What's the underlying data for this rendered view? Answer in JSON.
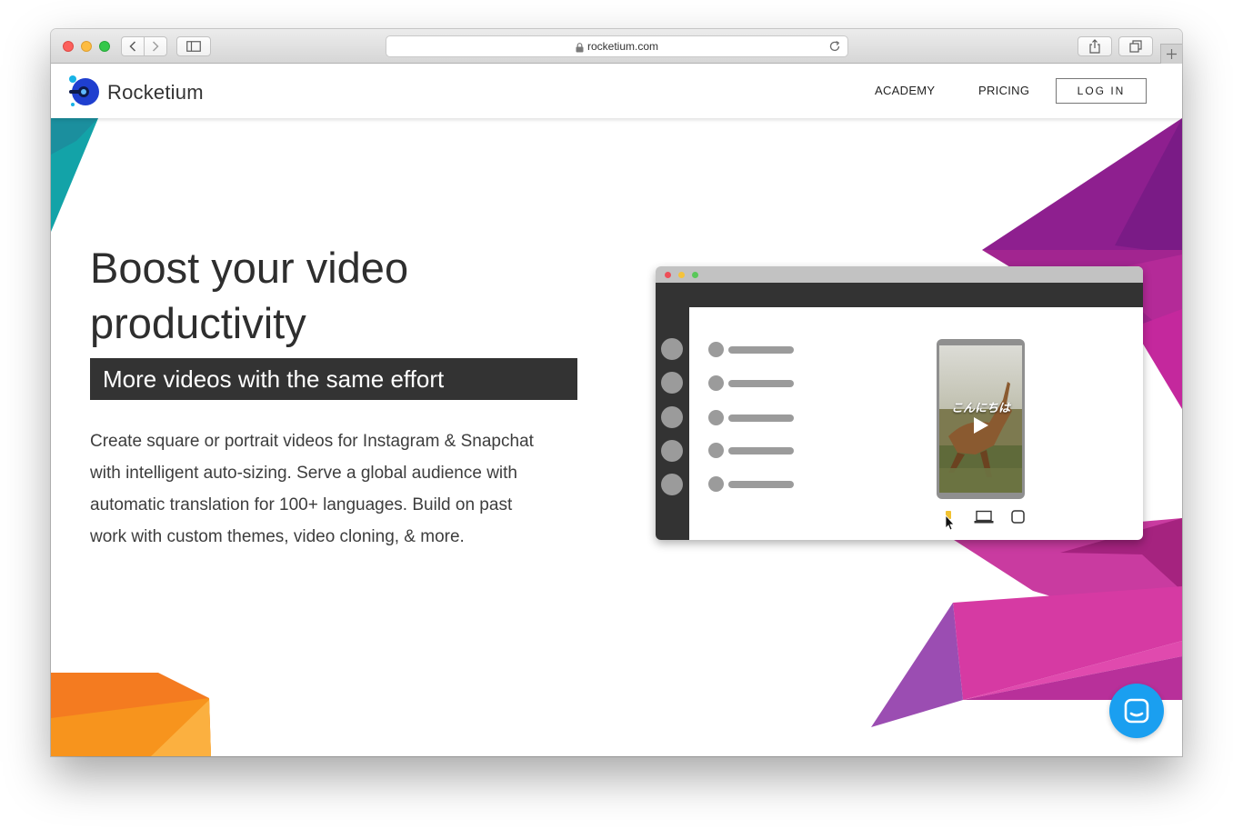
{
  "browser": {
    "url": "rocketium.com"
  },
  "site": {
    "brand": "Rocketium",
    "nav": {
      "academy": "ACADEMY",
      "pricing": "PRICING",
      "login": "LOG IN"
    }
  },
  "hero": {
    "headline_line1": "Boost your video",
    "headline_line2": "productivity",
    "tagline": "More videos with the same effort",
    "description": "Create square or portrait videos for Instagram & Snapchat with intelligent auto-sizing. Serve a global audience with automatic translation for 100+ languages. Build on past work with custom themes, video cloning, & more."
  },
  "mockup": {
    "video_text": "こんにちは"
  },
  "colors": {
    "tagline_bg": "#333333",
    "chat_button": "#1a9ff0",
    "accent_purple": "#8e1f8f",
    "accent_magenta": "#d63aa3",
    "accent_orange": "#f47b20",
    "accent_teal": "#13a3a8"
  },
  "icons": {
    "chat": "chat-bubble-icon",
    "lock": "lock-icon",
    "reload": "reload-icon"
  }
}
